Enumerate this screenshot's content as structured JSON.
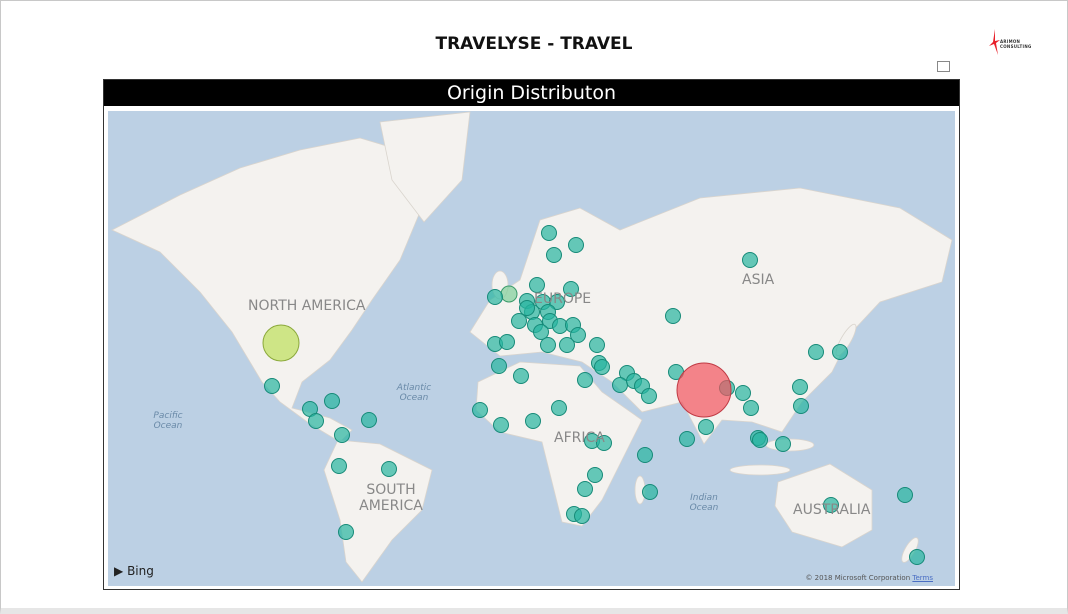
{
  "header": {
    "title": "TRAVELYSE - TRAVEL",
    "logo_text": "ARIMON CONSULTING"
  },
  "visual": {
    "title": "Origin Distributon",
    "expand_icon": "focus-mode-icon"
  },
  "map": {
    "labels": {
      "north_america": "NORTH AMERICA",
      "south_america": "SOUTH AMERICA",
      "europe": "EUROPE",
      "asia": "ASIA",
      "africa": "AFRICA",
      "australia": "AUSTRALIA",
      "atlantic": "Atlantic Ocean",
      "pacific": "Pacific Ocean",
      "indian": "Indian Ocean"
    },
    "bing": "Bing",
    "copyright": "© 2018 Microsoft Corporation",
    "terms": "Terms",
    "colors": {
      "land": "#f4f2ef",
      "water": "#bcd0e4",
      "bubble": "#26b5a0",
      "india": "#f2545e",
      "usa": "#bde05a"
    }
  }
}
